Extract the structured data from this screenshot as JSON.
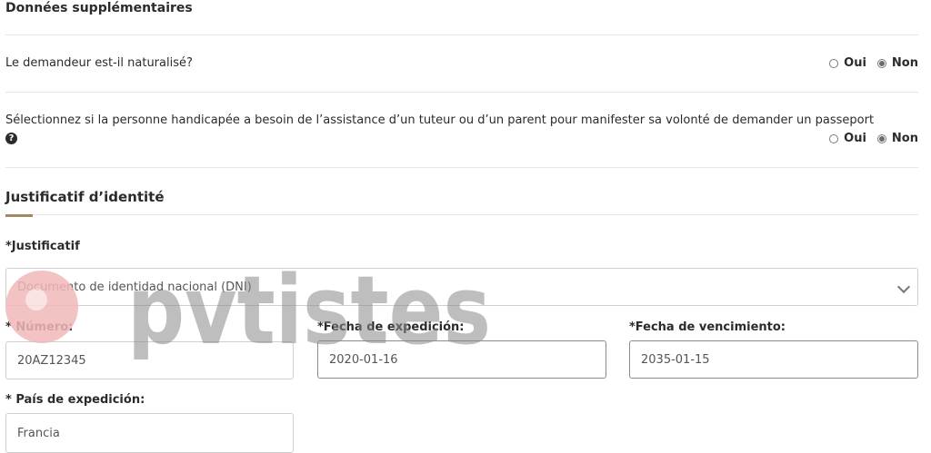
{
  "additional": {
    "title": "Données supplémentaires",
    "q1": {
      "text": "Le demandeur est-il naturalisé?",
      "yes": "Oui",
      "no": "Non",
      "selected": "Non"
    },
    "q2": {
      "text": "Sélectionnez si la personne handicapée a besoin de l’assistance d’un tuteur ou d’un parent pour manifester sa volonté de demander un passeport",
      "help_icon": "?",
      "yes": "Oui",
      "no": "Non",
      "selected": "Non"
    }
  },
  "identity": {
    "title": "Justificatif d’identité",
    "document_label": "*Justificatif",
    "document_value": "Documento de identidad nacional (DNI)",
    "number_label": "* Número:",
    "number_value": "20AZ12345",
    "issue_label": "*Fecha de expedición:",
    "issue_value": "2020-01-16",
    "expiry_label": "*Fecha de vencimiento:",
    "expiry_value": "2035-01-15",
    "country_label": "* País de expedición:",
    "country_value": "Francia"
  },
  "watermark": {
    "text": "pvtistes",
    "color": "#8a8a8a",
    "pin_color": "#f2b8b8"
  }
}
